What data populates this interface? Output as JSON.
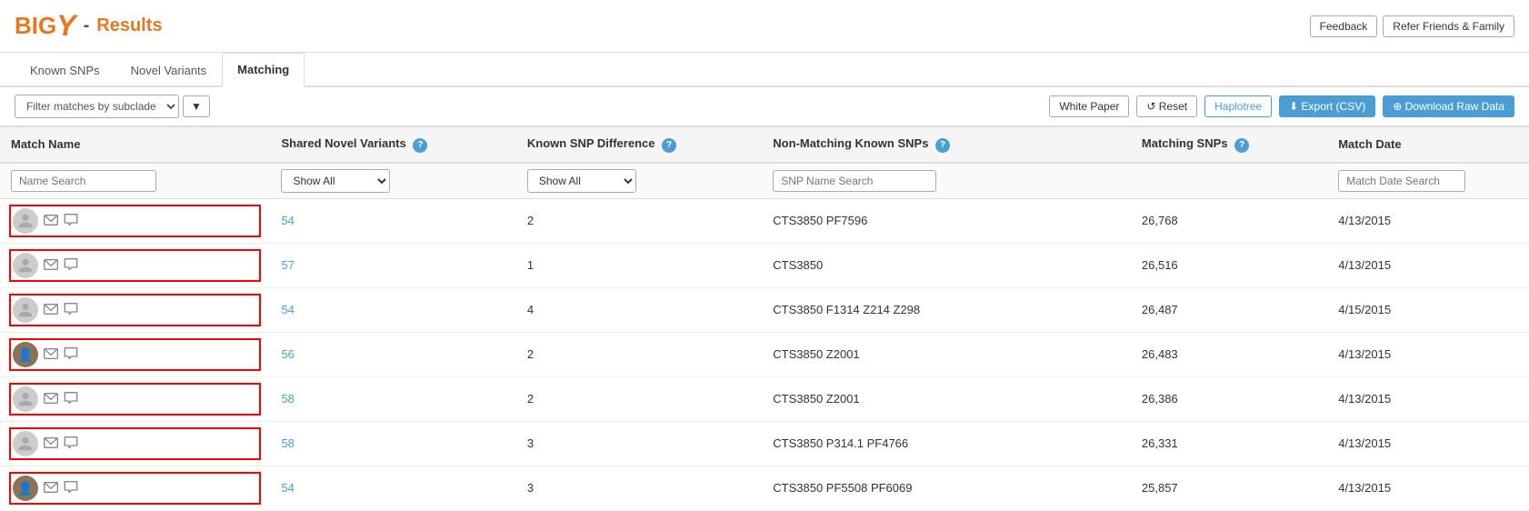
{
  "header": {
    "logo_big": "BIG",
    "logo_y": "Y",
    "logo_dash": "-",
    "logo_results": "Results",
    "btn_feedback": "Feedback",
    "btn_refer": "Refer Friends & Family"
  },
  "tabs": [
    {
      "label": "Known SNPs",
      "active": false
    },
    {
      "label": "Novel Variants",
      "active": false
    },
    {
      "label": "Matching",
      "active": true
    }
  ],
  "toolbar": {
    "filter_placeholder": "Filter matches by subclade",
    "btn_white_paper": "White Paper",
    "btn_reset": "↺ Reset",
    "btn_haplotree": "Haplotree",
    "btn_export": "⬇ Export (CSV)",
    "btn_download": "⊕ Download Raw Data"
  },
  "table": {
    "columns": [
      {
        "label": "Match Name",
        "help": false
      },
      {
        "label": "Shared Novel Variants",
        "help": true
      },
      {
        "label": "Known SNP Difference",
        "help": true
      },
      {
        "label": "Non-Matching Known SNPs",
        "help": true
      },
      {
        "label": "Matching SNPs",
        "help": true
      },
      {
        "label": "Match Date",
        "help": false
      }
    ],
    "filters": {
      "name_search": "Name Search",
      "show_all_snv": "Show All",
      "show_all_known": "Show All",
      "snp_name_search": "SNP Name Search",
      "matching_snps": "",
      "match_date_search": "Match Date Search"
    },
    "rows": [
      {
        "avatar_type": "person",
        "has_photo": false,
        "shared_novel": "54",
        "known_diff": "2",
        "non_matching": "CTS3850 PF7596",
        "matching_snps": "26,768",
        "match_date": "4/13/2015",
        "highlight": true
      },
      {
        "avatar_type": "person",
        "has_photo": false,
        "shared_novel": "57",
        "known_diff": "1",
        "non_matching": "CTS3850",
        "matching_snps": "26,516",
        "match_date": "4/13/2015",
        "highlight": true
      },
      {
        "avatar_type": "person",
        "has_photo": false,
        "shared_novel": "54",
        "known_diff": "4",
        "non_matching": "CTS3850 F1314 Z214 Z298",
        "matching_snps": "26,487",
        "match_date": "4/15/2015",
        "highlight": true
      },
      {
        "avatar_type": "photo",
        "has_photo": true,
        "shared_novel": "56",
        "known_diff": "2",
        "non_matching": "CTS3850 Z2001",
        "matching_snps": "26,483",
        "match_date": "4/13/2015",
        "highlight": true
      },
      {
        "avatar_type": "person",
        "has_photo": false,
        "shared_novel": "58",
        "known_diff": "2",
        "non_matching": "CTS3850 Z2001",
        "matching_snps": "26,386",
        "match_date": "4/13/2015",
        "highlight": true
      },
      {
        "avatar_type": "person",
        "has_photo": false,
        "shared_novel": "58",
        "known_diff": "3",
        "non_matching": "CTS3850 P314.1 PF4766",
        "matching_snps": "26,331",
        "match_date": "4/13/2015",
        "highlight": true
      },
      {
        "avatar_type": "photo",
        "has_photo": true,
        "shared_novel": "54",
        "known_diff": "3",
        "non_matching": "CTS3850 PF5508 PF6069",
        "matching_snps": "25,857",
        "match_date": "4/13/2015",
        "highlight": true
      }
    ]
  }
}
